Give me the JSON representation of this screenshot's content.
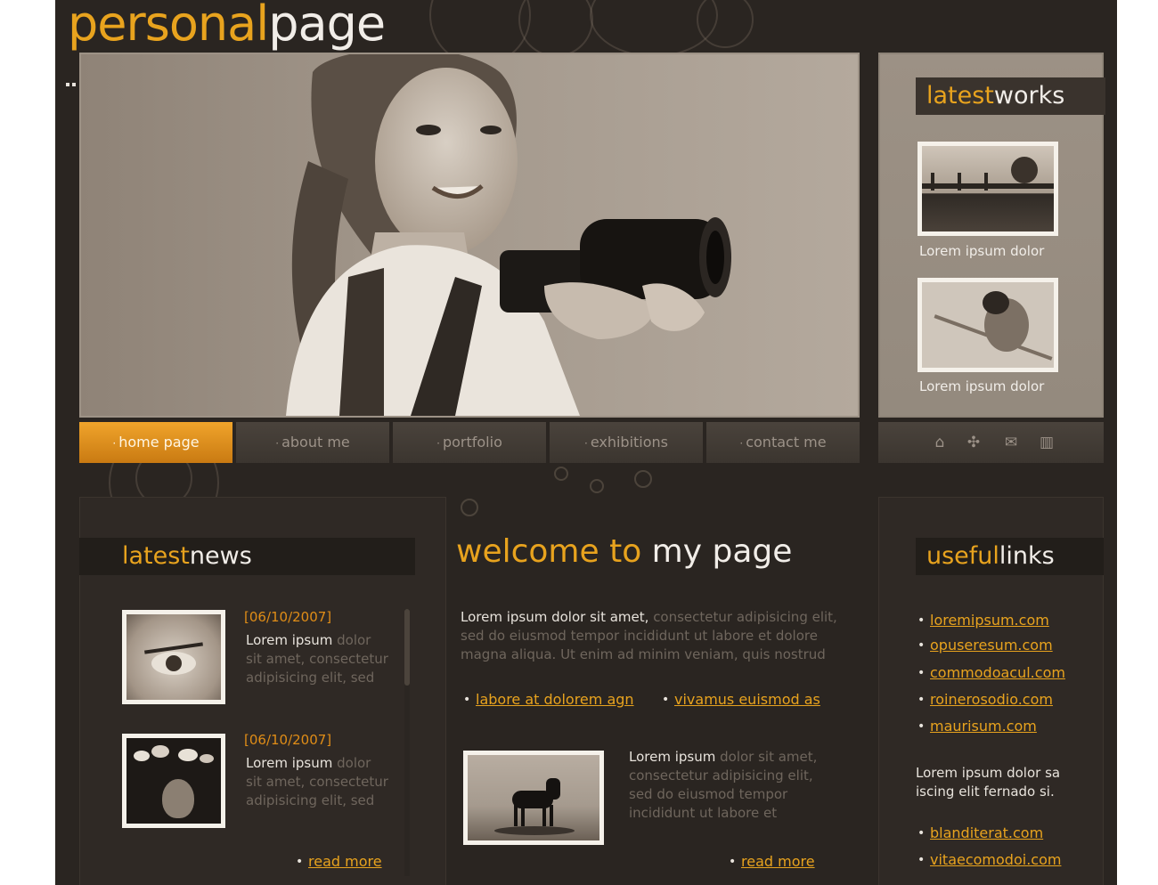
{
  "logo": {
    "part1": "personal",
    "part2": "page"
  },
  "latest_works": {
    "title_accent": "latest",
    "title_rest": "works",
    "items": [
      {
        "caption": "Lorem ipsum dolor"
      },
      {
        "caption": "Lorem ipsum dolor"
      }
    ]
  },
  "nav": {
    "items": [
      {
        "label": "home page",
        "active": true
      },
      {
        "label": "about me",
        "active": false
      },
      {
        "label": "portfolio",
        "active": false
      },
      {
        "label": "exhibitions",
        "active": false
      },
      {
        "label": "contact me",
        "active": false
      }
    ],
    "icons": [
      "home-icon",
      "sitemap-icon",
      "mail-icon",
      "trash-icon"
    ]
  },
  "latest_news": {
    "title_accent": "latest",
    "title_rest": "news",
    "items": [
      {
        "date": "[06/10/2007]",
        "lead": "Lorem ipsum",
        "text_a": "dolor",
        "text_b": "sit amet, consectetur",
        "text_c": "adipisicing elit, sed"
      },
      {
        "date": "[06/10/2007]",
        "lead": "Lorem ipsum",
        "text_a": "dolor",
        "text_b": "sit amet, consectetur",
        "text_c": "adipisicing elit, sed"
      }
    ],
    "read_more": "read more"
  },
  "welcome": {
    "title_accent": "welcome to",
    "title_rest": "my page",
    "intro_lead": "Lorem ipsum dolor sit amet,",
    "intro_line1": "consectetur adipisicing elit,",
    "intro_line2": "sed do eiusmod tempor incididunt ut labore et dolore",
    "intro_line3": "magna aliqua. Ut enim ad minim veniam, quis nostrud",
    "link1": "labore at dolorem agn",
    "link2": "vivamus euismod as",
    "para_lead": "Lorem ipsum",
    "para_line1": "dolor sit amet,",
    "para_line2": "consectetur adipisicing elit,",
    "para_line3": "sed do eiusmod tempor",
    "para_line4": "incididunt ut labore et",
    "read_more": "read more"
  },
  "useful_links": {
    "title_accent": "useful",
    "title_rest": "links",
    "links": [
      "loremipsum.com",
      "opuseresum.com",
      "commodoacul.com",
      "roinerosodio.com",
      "maurisum.com"
    ],
    "blurb_line1": "Lorem ipsum dolor sa",
    "blurb_line2": "iscing elit fernado si.",
    "links2": [
      "blanditerat.com",
      "vitaecomodoi.com"
    ]
  },
  "colors": {
    "accent": "#e8a31e",
    "background": "#2a2521",
    "light_text": "#e8e3dc"
  }
}
